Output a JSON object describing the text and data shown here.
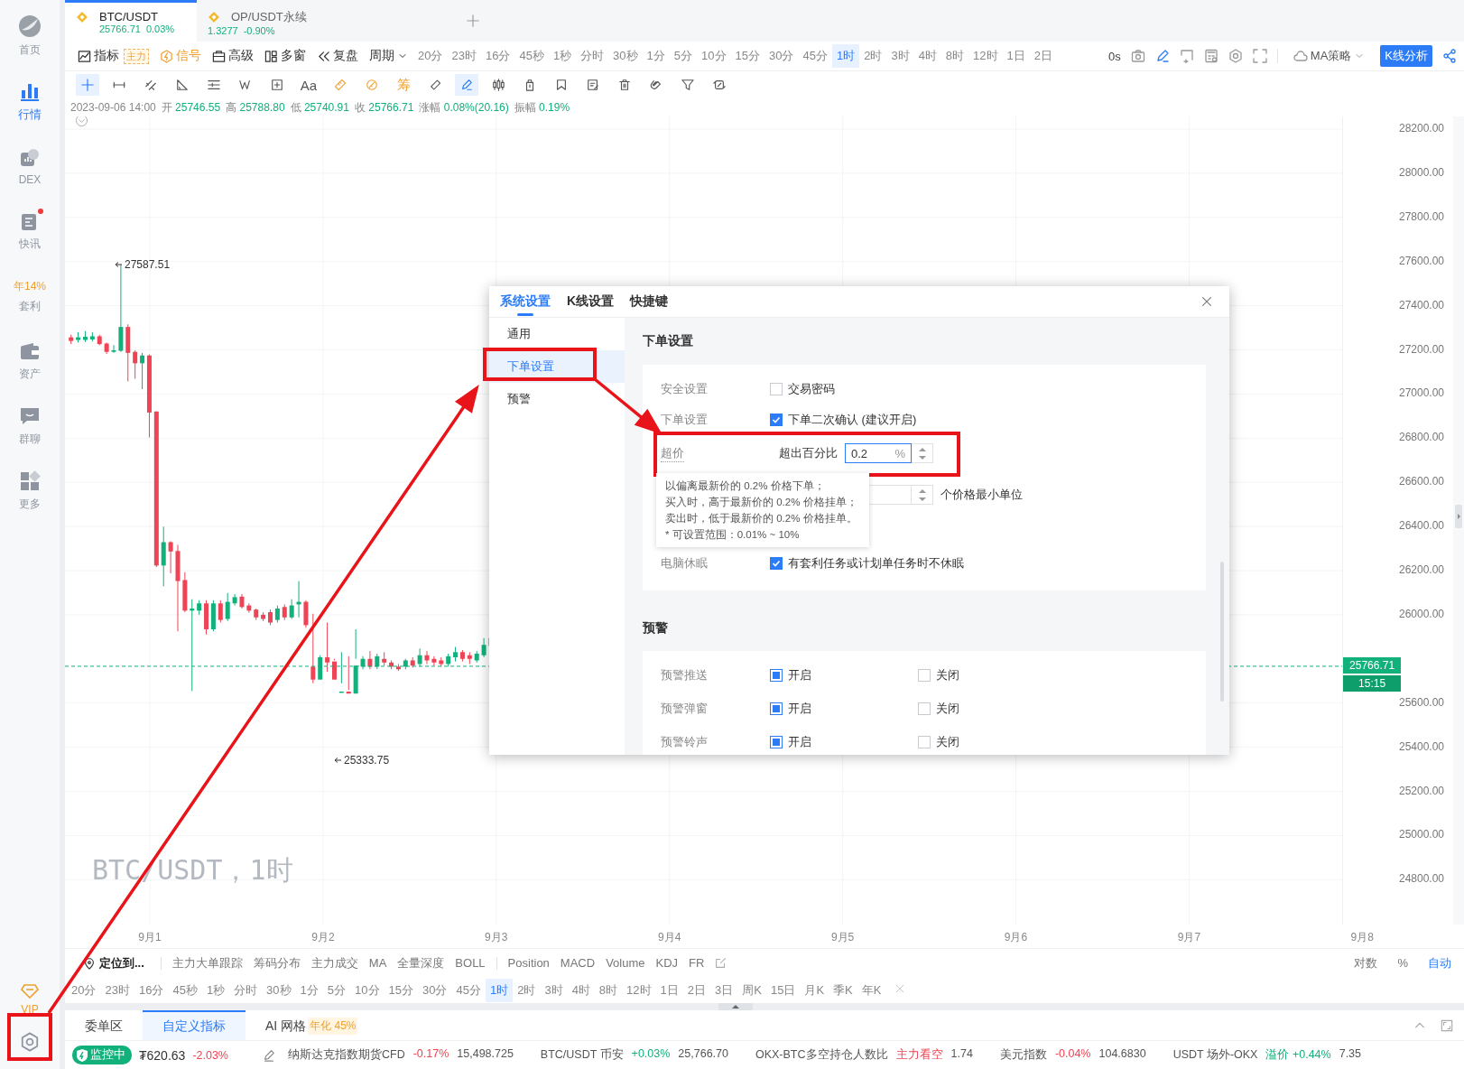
{
  "sidebar": {
    "items": [
      {
        "kind": "logo",
        "label": "首页",
        "selected": false,
        "unread": false
      },
      {
        "kind": "chart",
        "label": "行情",
        "selected": true,
        "unread": false
      },
      {
        "kind": "dex",
        "label": "DEX",
        "selected": false,
        "unread": false
      },
      {
        "kind": "news",
        "label": "快讯",
        "selected": false,
        "unread": true
      },
      {
        "kind": "promo",
        "highlight": "年14%",
        "label": "套利",
        "selected": false,
        "unread": false
      },
      {
        "kind": "wallet",
        "label": "资产",
        "selected": false,
        "unread": false
      },
      {
        "kind": "chat",
        "label": "群聊",
        "selected": false,
        "unread": false
      },
      {
        "kind": "apps",
        "label": "更多",
        "selected": false,
        "unread": false
      }
    ],
    "footer": {
      "label": "VIP"
    }
  },
  "tabs": [
    {
      "symbol": "BTC/USDT",
      "price": "25766.71",
      "change": "0.03%",
      "selected": true
    },
    {
      "symbol": "OP/USDT永续",
      "price": "1.3277",
      "change": "-0.90%",
      "selected": false
    }
  ],
  "toolbar": {
    "menus": [
      {
        "kind": "indicator",
        "label": "指标",
        "tag": "主力"
      },
      {
        "kind": "signal",
        "label": "信号"
      },
      {
        "kind": "advanced",
        "label": "高级"
      },
      {
        "kind": "multi",
        "label": "多窗"
      },
      {
        "kind": "replay",
        "label": "复盘"
      },
      {
        "kind": "period",
        "label": "周期"
      }
    ],
    "periods": [
      {
        "label": "20分",
        "selected": false
      },
      {
        "label": "23时",
        "selected": false
      },
      {
        "label": "16分",
        "selected": false
      },
      {
        "label": "45秒",
        "selected": false
      },
      {
        "label": "1秒",
        "selected": false
      },
      {
        "label": "分时",
        "selected": false
      },
      {
        "label": "30秒",
        "selected": false
      },
      {
        "label": "1分",
        "selected": false
      },
      {
        "label": "5分",
        "selected": false
      },
      {
        "label": "10分",
        "selected": false
      },
      {
        "label": "15分",
        "selected": false
      },
      {
        "label": "30分",
        "selected": false
      },
      {
        "label": "45分",
        "selected": false
      },
      {
        "label": "1时",
        "selected": true
      },
      {
        "label": "2时",
        "selected": false
      },
      {
        "label": "3时",
        "selected": false
      },
      {
        "label": "4时",
        "selected": false
      },
      {
        "label": "8时",
        "selected": false
      },
      {
        "label": "12时",
        "selected": false
      },
      {
        "label": "1日",
        "selected": false
      },
      {
        "label": "2日",
        "selected": false
      }
    ],
    "timer": "0s",
    "strategy": "MA策略",
    "analysis_button": "K线分析"
  },
  "drawing_tools": [
    {
      "kind": "crosshair",
      "active": true
    },
    {
      "kind": "hline",
      "active": false
    },
    {
      "kind": "parallel",
      "active": false
    },
    {
      "kind": "angle",
      "active": false
    },
    {
      "kind": "lines",
      "active": false
    },
    {
      "kind": "wave",
      "active": false
    },
    {
      "kind": "boxplus",
      "active": false
    },
    {
      "kind": "text",
      "label": "Aa",
      "active": false
    },
    {
      "kind": "measure",
      "active": false
    },
    {
      "kind": "range",
      "active": false
    },
    {
      "kind": "chip",
      "label": "筹",
      "active": false
    },
    {
      "kind": "ruler",
      "active": false
    },
    {
      "kind": "pen",
      "active": true
    },
    {
      "kind": "candles",
      "active": false
    },
    {
      "kind": "lock",
      "active": false
    },
    {
      "kind": "bookmark",
      "active": false
    },
    {
      "kind": "note",
      "active": false
    },
    {
      "kind": "trash",
      "active": false
    },
    {
      "kind": "magnet",
      "active": false
    },
    {
      "kind": "filter",
      "active": false
    },
    {
      "kind": "sync",
      "active": false
    }
  ],
  "ohlc": {
    "time": "2023-09-06 14:00",
    "fields": [
      {
        "label": "开",
        "value": "25746.55"
      },
      {
        "label": "高",
        "value": "25788.80"
      },
      {
        "label": "低",
        "value": "25740.91"
      },
      {
        "label": "收",
        "value": "25766.71"
      },
      {
        "label": "涨幅",
        "value": "0.08%(20.16)"
      },
      {
        "label": "振幅",
        "value": "0.19%"
      }
    ]
  },
  "chart": {
    "high_marker": "27587.51",
    "low_marker": "25333.75",
    "watermark": "BTC/USDT，1时",
    "price_ticks": [
      "28200.00",
      "28000.00",
      "27800.00",
      "27600.00",
      "27400.00",
      "27200.00",
      "27000.00",
      "26800.00",
      "26600.00",
      "26400.00",
      "26200.00",
      "26000.00",
      "25600.00",
      "25400.00",
      "25200.00",
      "25000.00",
      "24800.00"
    ],
    "last_price": "25766.71",
    "countdown": "15:15",
    "dates": [
      "9月1",
      "9月2",
      "9月3",
      "9月4",
      "9月5",
      "9月6",
      "9月7",
      "9月8"
    ]
  },
  "indicator_bar": {
    "locate": "定位到...",
    "groups": [
      [
        "主力大单跟踪",
        "筹码分布",
        "主力成交",
        "MA",
        "全量深度",
        "BOLL"
      ],
      [
        "Position",
        "MACD",
        "Volume",
        "KDJ",
        "FR"
      ]
    ],
    "scale_options": [
      {
        "label": "对数",
        "selected": false
      },
      {
        "label": "%",
        "selected": false
      },
      {
        "label": "自动",
        "selected": true
      }
    ]
  },
  "period_bar": [
    {
      "label": "20分",
      "selected": false
    },
    {
      "label": "23时",
      "selected": false
    },
    {
      "label": "16分",
      "selected": false
    },
    {
      "label": "45秒",
      "selected": false
    },
    {
      "label": "1秒",
      "selected": false
    },
    {
      "label": "分时",
      "selected": false
    },
    {
      "label": "30秒",
      "selected": false
    },
    {
      "label": "1分",
      "selected": false
    },
    {
      "label": "5分",
      "selected": false
    },
    {
      "label": "10分",
      "selected": false
    },
    {
      "label": "15分",
      "selected": false
    },
    {
      "label": "30分",
      "selected": false
    },
    {
      "label": "45分",
      "selected": false
    },
    {
      "label": "1时",
      "selected": true
    },
    {
      "label": "2时",
      "selected": false
    },
    {
      "label": "3时",
      "selected": false
    },
    {
      "label": "4时",
      "selected": false
    },
    {
      "label": "8时",
      "selected": false
    },
    {
      "label": "12时",
      "selected": false
    },
    {
      "label": "1日",
      "selected": false
    },
    {
      "label": "2日",
      "selected": false
    },
    {
      "label": "3日",
      "selected": false
    },
    {
      "label": "周K",
      "selected": false
    },
    {
      "label": "15日",
      "selected": false
    },
    {
      "label": "月K",
      "selected": false
    },
    {
      "label": "季K",
      "selected": false
    },
    {
      "label": "年K",
      "selected": false
    }
  ],
  "bottom_tabs": [
    {
      "label": "委单区",
      "selected": false
    },
    {
      "label": "自定义指标",
      "selected": true
    },
    {
      "label": "AI 网格",
      "badge": "年化 45%",
      "selected": false
    }
  ],
  "ticker": {
    "status": "监控中",
    "price": "₮620.63",
    "change": "-2.03%",
    "color": "#ee4455",
    "items": [
      {
        "name": "纳斯达克指数期货CFD",
        "change": "-0.17%",
        "color": "#ee4455",
        "value": "15,498.725"
      },
      {
        "name": "BTC/USDT 币安",
        "change": "+0.03%",
        "color": "#12b07b",
        "value": "25,766.70"
      },
      {
        "name": "OKX-BTC多空持仓人数比",
        "change": "主力看空",
        "color": "#ee4455",
        "value": "1.74"
      },
      {
        "name": "美元指数",
        "change": "-0.04%",
        "color": "#ee4455",
        "value": "104.6830"
      },
      {
        "name": "USDT 场外-OKX",
        "change": "溢价 +0.44%",
        "color": "#12b07b",
        "value": "7.35"
      }
    ]
  },
  "dialog": {
    "tabs": [
      {
        "label": "系统设置",
        "selected": true
      },
      {
        "label": "K线设置",
        "selected": false
      },
      {
        "label": "快捷键",
        "selected": false
      }
    ],
    "nav": [
      {
        "label": "通用",
        "selected": false
      },
      {
        "label": "下单设置",
        "selected": true
      },
      {
        "label": "预警",
        "selected": false
      }
    ],
    "sections": [
      {
        "title": "下单设置",
        "rows": [
          {
            "kind": "checkbox",
            "label": "安全设置",
            "text": "交易密码",
            "checked": false
          },
          {
            "kind": "checkbox",
            "label": "下单设置",
            "text": "下单二次确认 (建议开启)",
            "checked": true
          },
          {
            "kind": "percent",
            "label": "超价",
            "text": "超出百分比",
            "value": "0.2",
            "unit": "%"
          },
          {
            "kind": "stepper",
            "suffix": "个价格最小单位"
          },
          {
            "kind": "checkbox",
            "label": "电脑休眠",
            "text": "有套利任务或计划单任务时不休眠",
            "checked": true
          }
        ]
      },
      {
        "title": "预警",
        "rows": [
          {
            "kind": "options",
            "label": "预警推送",
            "options": [
              {
                "label": "开启",
                "selected": true
              },
              {
                "label": "关闭",
                "selected": false
              }
            ]
          },
          {
            "kind": "options",
            "label": "预警弹窗",
            "options": [
              {
                "label": "开启",
                "selected": true
              },
              {
                "label": "关闭",
                "selected": false
              }
            ]
          },
          {
            "kind": "options",
            "label": "预警铃声",
            "options": [
              {
                "label": "开启",
                "selected": true
              },
              {
                "label": "关闭",
                "selected": false
              }
            ]
          }
        ]
      }
    ],
    "tooltip": [
      "以偏离最新价的 0.2% 价格下单；",
      "买入时，高于最新价的 0.2% 价格挂单；",
      "卖出时，低于最新价的 0.2% 价格挂单。",
      "* 可设置范围：0.01% ~ 10%"
    ]
  }
}
